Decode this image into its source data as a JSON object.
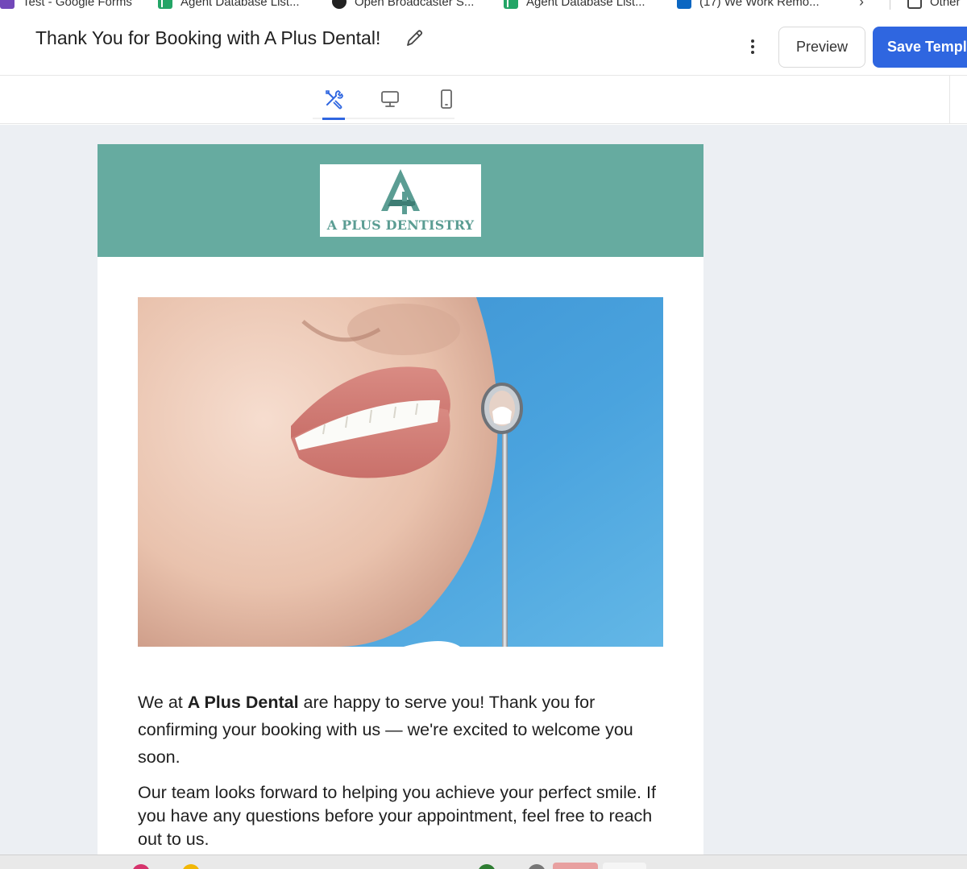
{
  "bookmarks": [
    {
      "label": "Test - Google Forms",
      "icon": "google-forms-icon"
    },
    {
      "label": "Agent Database List...",
      "icon": "google-sheets-icon"
    },
    {
      "label": "Open Broadcaster S...",
      "icon": "obs-icon"
    },
    {
      "label": "Agent Database List...",
      "icon": "google-sheets-icon"
    },
    {
      "label": "(17) We Work Remo...",
      "icon": "linkedin-icon"
    },
    {
      "label": "Other",
      "icon": "folder-icon"
    }
  ],
  "header": {
    "title": "Thank You for Booking with A Plus Dental!",
    "preview_label": "Preview",
    "save_label": "Save Templ"
  },
  "view_tabs": [
    {
      "name": "design-tools",
      "active": true
    },
    {
      "name": "desktop-view",
      "active": false
    },
    {
      "name": "mobile-view",
      "active": false
    }
  ],
  "email": {
    "banner_color": "#66aba0",
    "logo_text": "A PLUS DENTISTRY",
    "hero_icon": "smiling-woman-dental-mirror-photo",
    "p1_before": "We at ",
    "p1_bold": "A Plus Dental",
    "p1_after": " are happy to serve you! Thank you for confirming your booking with us — we're excited to welcome you soon.",
    "p2": "Our team looks forward to helping you achieve your perfect smile. If you have any questions before your appointment, feel free to reach out to us."
  },
  "colors": {
    "accent": "#2f66e0",
    "canvas_bg": "#eceff3",
    "teal": "#66aba0"
  }
}
